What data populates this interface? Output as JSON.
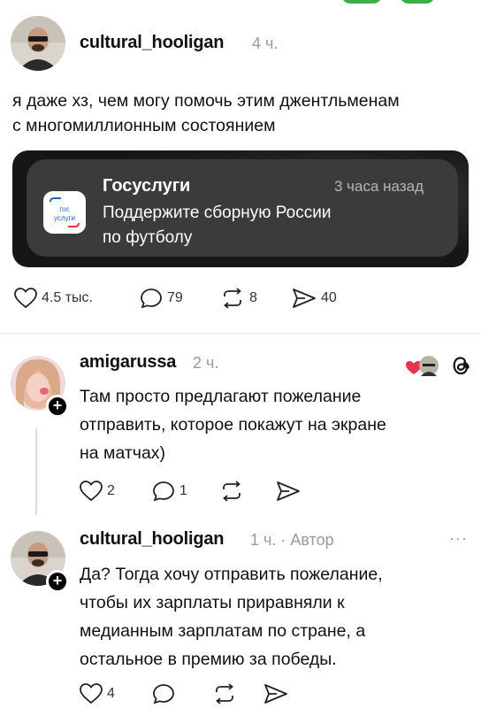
{
  "post": {
    "username": "cultural_hooligan",
    "time": "4 ч.",
    "text_line1": "я даже хз, чем могу помочь этим джентльменам",
    "text_line2": "с многомиллионным состоянием",
    "notification": {
      "app_name": "Госуслуги",
      "time": "3 часа назад",
      "body_line1": "Поддержите сборную России",
      "body_line2": "по футболу",
      "icon_text_top": "гос",
      "icon_text_bottom": "услуги"
    },
    "stats": {
      "likes": "4.5 тыс.",
      "comments": "79",
      "reposts": "8",
      "shares": "40"
    }
  },
  "reply1": {
    "username": "amigarussa",
    "time": "2 ч.",
    "lines": [
      "Там просто предлагают пожелание",
      "отправить, которое покажут на экране",
      "на матчах)"
    ],
    "stats": {
      "likes": "2",
      "comments": "1"
    }
  },
  "reply2": {
    "username": "cultural_hooligan",
    "time": "1 ч. · Автор",
    "lines": [
      "Да? Тогда хочу отправить пожелание,",
      "чтобы их зарплаты приравняли к",
      "медианным зарплатам по стране, а",
      "остальное в премию за победы."
    ],
    "stats": {
      "likes": "4"
    },
    "more_label": "···"
  },
  "colors": {
    "accent_red": "#e0364a",
    "muted": "#9a9a9a",
    "notif_bg": "#3b3b3d"
  }
}
